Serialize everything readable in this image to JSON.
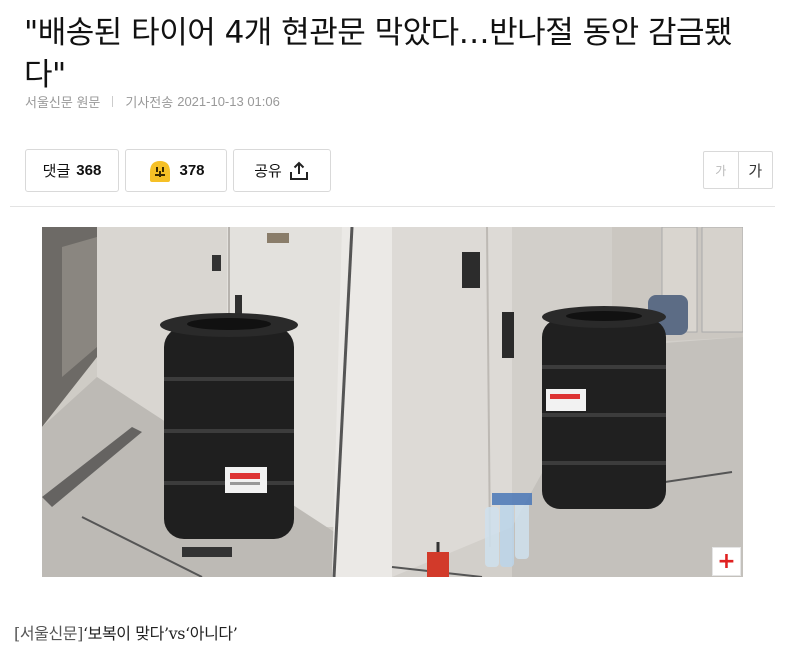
{
  "article": {
    "title": "\"배송된 타이어 4개 현관문 막았다…반나절 동안 감금됐다\"",
    "source": "서울신문 원문",
    "published_label": "기사전송",
    "published_at": "2021-10-13 01:06"
  },
  "actions": {
    "comment_label": "댓글",
    "comment_count": "368",
    "reaction_count": "378",
    "reaction_icon": "emoji-face-icon",
    "share_label": "공유",
    "share_icon": "share-upload-icon"
  },
  "font_size": {
    "small_label": "가",
    "large_label": "가"
  },
  "photo": {
    "expand_label": "+",
    "caption_source": "[서울신문]",
    "caption_text": "‘보복이 맞다’vs‘아니다’"
  },
  "colors": {
    "accent_red": "#e02020",
    "reaction_yellow": "#f6c026"
  }
}
